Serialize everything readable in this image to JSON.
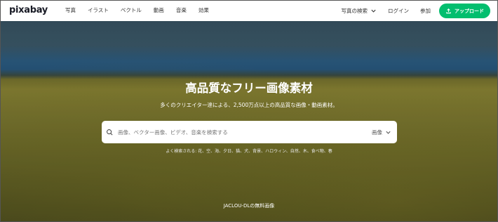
{
  "header": {
    "logo": "pixabay",
    "nav": [
      "写真",
      "イラスト",
      "ベクトル",
      "動画",
      "音楽",
      "効果"
    ],
    "explore": "写真の検索",
    "login": "ログイン",
    "join": "参加",
    "upload": "アップロード"
  },
  "hero": {
    "title": "高品質なフリー画像素材",
    "subtitle": "多くのクリエイター達による、2,500万点以上の高品質な画像・動画素材。",
    "search": {
      "placeholder": "画像、ベクター画像、ビデオ、音楽を検索する",
      "type": "画像"
    },
    "tags": "よく検索される: 花、空、海、夕日、猫、犬、背景、ハロウィン、自然、木、食べ物、春",
    "credit": "JACLOU-DLの無料画像"
  },
  "colors": {
    "upload_green": "#02be6e",
    "header_bg": "#ffffff"
  }
}
